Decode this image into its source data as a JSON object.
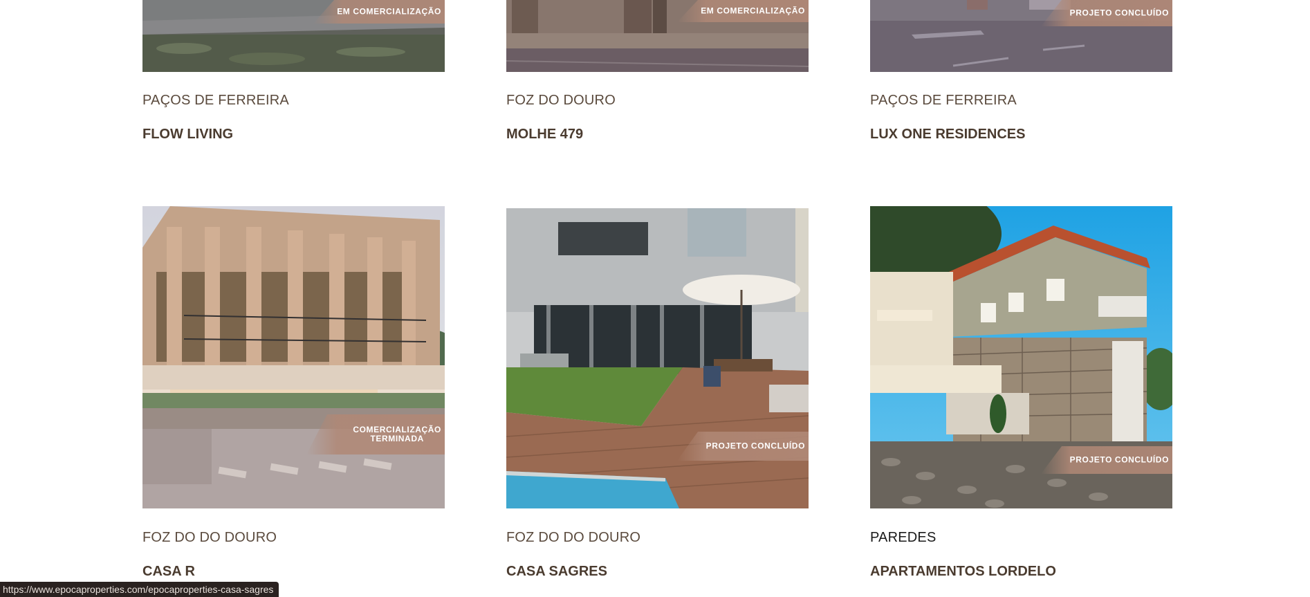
{
  "projects_top": [
    {
      "location": "PAÇOS DE FERREIRA",
      "name": "FLOW LIVING",
      "status": "EM COMERCIALIZAÇÃO"
    },
    {
      "location": "FOZ DO DOURO",
      "name": "MOLHE 479",
      "status": "EM COMERCIALIZAÇÃO"
    },
    {
      "location": "PAÇOS DE FERREIRA",
      "name": "LUX ONE RESIDENCES",
      "status": "PROJETO CONCLUÍDO"
    }
  ],
  "projects_bottom": [
    {
      "location": "FOZ DO DO DOURO",
      "name": "CASA R",
      "status": "COMERCIALIZAÇÃO\nTERMINADA"
    },
    {
      "location": "FOZ DO DO DOURO",
      "name": "CASA SAGRES",
      "status": "PROJETO CONCLUÍDO"
    },
    {
      "location": "PAREDES",
      "name": "APARTAMENTOS LORDELO",
      "status": "PROJETO CONCLUÍDO"
    }
  ],
  "status_bar": {
    "url": "https://www.epocaproperties.com/epocaproperties-casa-sagres"
  },
  "colors": {
    "text_brown": "#5a4a3d",
    "badge": "#b08876",
    "status_bar_bg": "#2a2220"
  }
}
